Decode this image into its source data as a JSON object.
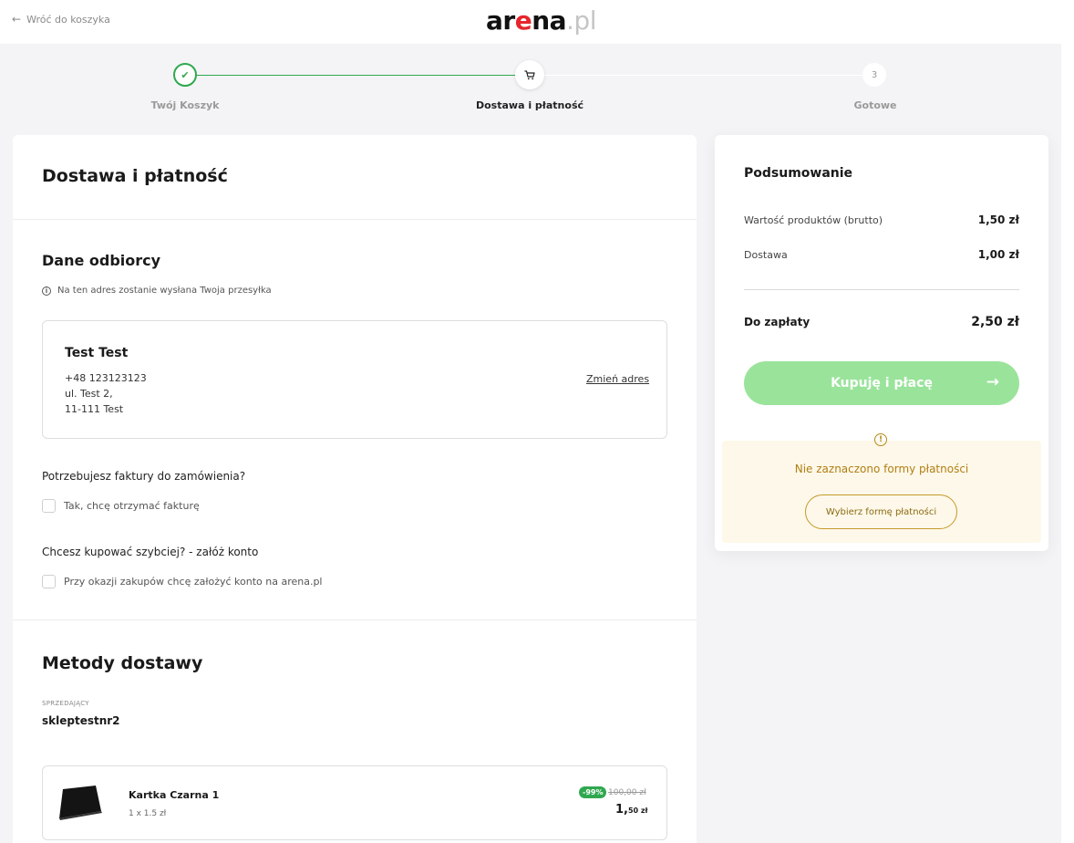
{
  "header": {
    "back_label": "Wróć do koszyka",
    "logo": {
      "part1": "ar",
      "part2": "e",
      "part3": "na",
      "part4": ".pl"
    }
  },
  "stepper": {
    "steps": [
      {
        "label": "Twój Koszyk",
        "status": "done",
        "marker": "✔"
      },
      {
        "label": "Dostawa i płatność",
        "status": "current",
        "marker": "cart-icon"
      },
      {
        "label": "Gotowe",
        "status": "todo",
        "marker": "3"
      }
    ]
  },
  "main": {
    "title": "Dostawa i płatność",
    "recipient": {
      "title": "Dane odbiorcy",
      "info": "Na ten adres zostanie wysłana Twoja przesyłka",
      "name": "Test Test",
      "phone": "+48 123123123",
      "street": "ul. Test 2,",
      "city": "11-111 Test",
      "change_label": "Zmień adres"
    },
    "invoice": {
      "question": "Potrzebujesz faktury do zamówienia?",
      "checkbox_label": "Tak, chcę otrzymać fakturę",
      "checked": false
    },
    "account": {
      "question": "Chcesz kupować szybciej? - załóż konto",
      "checkbox_label": "Przy okazji zakupów chcę założyć konto na arena.pl",
      "checked": false
    },
    "shipping": {
      "title": "Metody dostawy",
      "seller_label": "SPRZEDAJĄCY",
      "seller_name": "skleptestnr2",
      "product": {
        "name": "Kartka Czarna 1",
        "qty": "1 x 1.5 zł",
        "discount": "-99%",
        "old_price": "100,00 zł",
        "price_main": "1,",
        "price_rest": "50 zł"
      }
    }
  },
  "summary": {
    "title": "Podsumowanie",
    "products_label": "Wartość produktów (brutto)",
    "products_value": "1,50 zł",
    "delivery_label": "Dostawa",
    "delivery_value": "1,00 zł",
    "total_label": "Do zapłaty",
    "total_value": "2,50 zł",
    "buy_label": "Kupuję i płacę",
    "warning_text": "Nie zaznaczono formy płatności",
    "warning_button": "Wybierz formę płatności"
  },
  "colors": {
    "accent_green": "#2fa84f",
    "buy_button": "#9ae39b",
    "warning_bg": "#fef8ea",
    "warning_text": "#b07f12",
    "logo_red": "#e5262d"
  }
}
